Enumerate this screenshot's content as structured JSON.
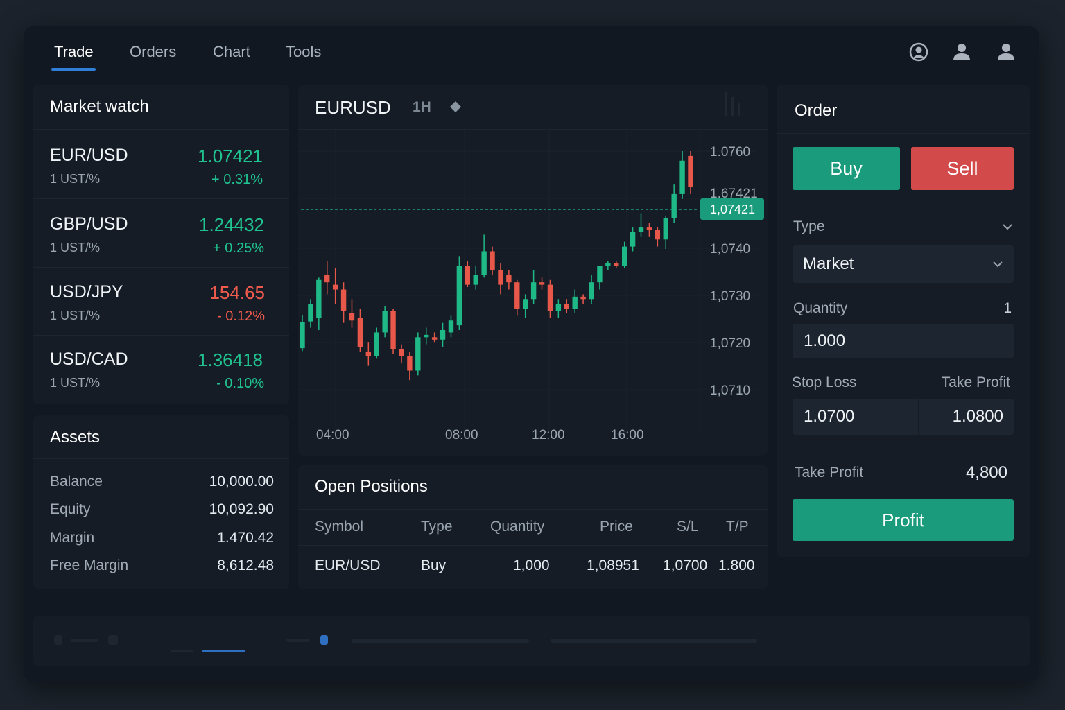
{
  "nav": {
    "tabs": [
      {
        "label": "Trade",
        "active": true
      },
      {
        "label": "Orders",
        "active": false
      },
      {
        "label": "Chart",
        "active": false
      },
      {
        "label": "Tools",
        "active": false
      }
    ],
    "icons": [
      "account-circle-icon",
      "user-icon",
      "user-icon"
    ]
  },
  "market_watch": {
    "title": "Market watch",
    "items": [
      {
        "symbol": "EUR/USD",
        "sub": "1 UST/%",
        "price": "1.07421",
        "change": "+ 0.31%",
        "direction": "up"
      },
      {
        "symbol": "GBP/USD",
        "sub": "1 UST/%",
        "price": "1.24432",
        "change": "+ 0.25%",
        "direction": "up"
      },
      {
        "symbol": "USD/JPY",
        "sub": "1 UST/%",
        "price": "154.65",
        "change": "- 0.12%",
        "direction": "down"
      },
      {
        "symbol": "USD/CAD",
        "sub": "1 UST/%",
        "price": "1.36418",
        "change": "- 0.10%",
        "direction": "up"
      }
    ]
  },
  "assets": {
    "title": "Assets",
    "rows": [
      {
        "label": "Balance",
        "value": "10,000.00"
      },
      {
        "label": "Equity",
        "value": "10,092.90"
      },
      {
        "label": "Margin",
        "value": "1.470.42"
      },
      {
        "label": "Free Margin",
        "value": "8,612.48"
      }
    ]
  },
  "chart": {
    "symbol": "EURUSD",
    "timeframe": "1H",
    "y_labels": [
      "1.0760",
      "1,67421",
      "1,0740",
      "1,0730",
      "1,0720",
      "1,0710"
    ],
    "x_labels": [
      "04:00",
      "08:00",
      "12:00",
      "16:00"
    ],
    "current_price_label": "1,07421"
  },
  "chart_data": {
    "type": "candlestick",
    "title": "EURUSD",
    "timeframe": "1H",
    "ylim": [
      1.0705,
      1.0765
    ],
    "x_ticks": [
      "04:00",
      "08:00",
      "12:00",
      "16:00"
    ],
    "current_price": 1.07421,
    "up_color": "#1fb987",
    "down_color": "#e8584a",
    "candles": [
      {
        "o": 1.07187,
        "h": 1.07257,
        "l": 1.07181,
        "c": 1.07242
      },
      {
        "o": 1.07243,
        "h": 1.0729,
        "l": 1.0723,
        "c": 1.07279
      },
      {
        "o": 1.0725,
        "h": 1.07335,
        "l": 1.07225,
        "c": 1.0733
      },
      {
        "o": 1.0734,
        "h": 1.0737,
        "l": 1.073,
        "c": 1.07325
      },
      {
        "o": 1.0732,
        "h": 1.07355,
        "l": 1.0728,
        "c": 1.0731
      },
      {
        "o": 1.0731,
        "h": 1.07325,
        "l": 1.0724,
        "c": 1.07265
      },
      {
        "o": 1.0726,
        "h": 1.0729,
        "l": 1.0723,
        "c": 1.07245
      },
      {
        "o": 1.0725,
        "h": 1.0727,
        "l": 1.0718,
        "c": 1.0719
      },
      {
        "o": 1.0718,
        "h": 1.072,
        "l": 1.0715,
        "c": 1.0717
      },
      {
        "o": 1.0717,
        "h": 1.0723,
        "l": 1.07165,
        "c": 1.0722
      },
      {
        "o": 1.0722,
        "h": 1.07275,
        "l": 1.0721,
        "c": 1.07265
      },
      {
        "o": 1.07265,
        "h": 1.0727,
        "l": 1.07175,
        "c": 1.07185
      },
      {
        "o": 1.07185,
        "h": 1.07195,
        "l": 1.07155,
        "c": 1.0717
      },
      {
        "o": 1.0717,
        "h": 1.0718,
        "l": 1.0712,
        "c": 1.0714
      },
      {
        "o": 1.0714,
        "h": 1.0722,
        "l": 1.0713,
        "c": 1.0721
      },
      {
        "o": 1.0721,
        "h": 1.0723,
        "l": 1.07195,
        "c": 1.07215
      },
      {
        "o": 1.0721,
        "h": 1.0722,
        "l": 1.072,
        "c": 1.07205
      },
      {
        "o": 1.07205,
        "h": 1.0724,
        "l": 1.0719,
        "c": 1.07225
      },
      {
        "o": 1.0722,
        "h": 1.07255,
        "l": 1.0721,
        "c": 1.07245
      },
      {
        "o": 1.07235,
        "h": 1.0738,
        "l": 1.07225,
        "c": 1.0736
      },
      {
        "o": 1.0736,
        "h": 1.0737,
        "l": 1.07315,
        "c": 1.0732
      },
      {
        "o": 1.0732,
        "h": 1.0736,
        "l": 1.0731,
        "c": 1.0734
      },
      {
        "o": 1.0734,
        "h": 1.07425,
        "l": 1.07335,
        "c": 1.0739
      },
      {
        "o": 1.0739,
        "h": 1.074,
        "l": 1.0734,
        "c": 1.0735
      },
      {
        "o": 1.0735,
        "h": 1.07365,
        "l": 1.073,
        "c": 1.0732
      },
      {
        "o": 1.0734,
        "h": 1.0735,
        "l": 1.0731,
        "c": 1.07325
      },
      {
        "o": 1.07325,
        "h": 1.0733,
        "l": 1.07255,
        "c": 1.0727
      },
      {
        "o": 1.0727,
        "h": 1.073,
        "l": 1.0725,
        "c": 1.0729
      },
      {
        "o": 1.0729,
        "h": 1.0735,
        "l": 1.0728,
        "c": 1.07325
      },
      {
        "o": 1.07325,
        "h": 1.07335,
        "l": 1.0731,
        "c": 1.0732
      },
      {
        "o": 1.0732,
        "h": 1.0733,
        "l": 1.0725,
        "c": 1.07265
      },
      {
        "o": 1.07265,
        "h": 1.0729,
        "l": 1.0725,
        "c": 1.0728
      },
      {
        "o": 1.0728,
        "h": 1.0729,
        "l": 1.0726,
        "c": 1.0727
      },
      {
        "o": 1.0727,
        "h": 1.0731,
        "l": 1.0726,
        "c": 1.07295
      },
      {
        "o": 1.07295,
        "h": 1.073,
        "l": 1.0728,
        "c": 1.0729
      },
      {
        "o": 1.0729,
        "h": 1.0734,
        "l": 1.0728,
        "c": 1.07325
      },
      {
        "o": 1.07325,
        "h": 1.0736,
        "l": 1.0731,
        "c": 1.0736
      },
      {
        "o": 1.0736,
        "h": 1.0737,
        "l": 1.0735,
        "c": 1.07365
      },
      {
        "o": 1.07365,
        "h": 1.0737,
        "l": 1.07355,
        "c": 1.0736
      },
      {
        "o": 1.0736,
        "h": 1.0741,
        "l": 1.07355,
        "c": 1.074
      },
      {
        "o": 1.074,
        "h": 1.0744,
        "l": 1.0739,
        "c": 1.0743
      },
      {
        "o": 1.0743,
        "h": 1.0747,
        "l": 1.0742,
        "c": 1.0744
      },
      {
        "o": 1.0744,
        "h": 1.0745,
        "l": 1.0742,
        "c": 1.07435
      },
      {
        "o": 1.07435,
        "h": 1.0744,
        "l": 1.074,
        "c": 1.07415
      },
      {
        "o": 1.07415,
        "h": 1.07465,
        "l": 1.07395,
        "c": 1.0746
      },
      {
        "o": 1.0746,
        "h": 1.0753,
        "l": 1.0745,
        "c": 1.0751
      },
      {
        "o": 1.0751,
        "h": 1.076,
        "l": 1.075,
        "c": 1.0758
      },
      {
        "o": 1.0759,
        "h": 1.076,
        "l": 1.0751,
        "c": 1.07525
      }
    ]
  },
  "positions": {
    "title": "Open Positions",
    "columns": [
      "Symbol",
      "Type",
      "Quantity",
      "Price",
      "S/L",
      "T/P"
    ],
    "rows": [
      {
        "symbol": "EUR/USD",
        "type": "Buy",
        "quantity": "1,000",
        "price": "1,08951",
        "sl": "1,0700",
        "tp": "1.800"
      }
    ]
  },
  "order": {
    "title": "Order",
    "buy_label": "Buy",
    "sell_label": "Sell",
    "type_label": "Type",
    "type_value": "Market",
    "quantity_label": "Quantity",
    "quantity_step": "1",
    "quantity_value": "1.000",
    "stop_loss_label": "Stop Loss",
    "take_profit_label": "Take Profit",
    "stop_loss_value": "1.0700",
    "take_profit_value": "1.0800",
    "tp_summary_label": "Take Profit",
    "tp_summary_value": "4,800",
    "submit_label": "Profit"
  },
  "colors": {
    "green": "#1a9c7c",
    "red": "#d24a4a",
    "accent": "#2f7fd8"
  }
}
